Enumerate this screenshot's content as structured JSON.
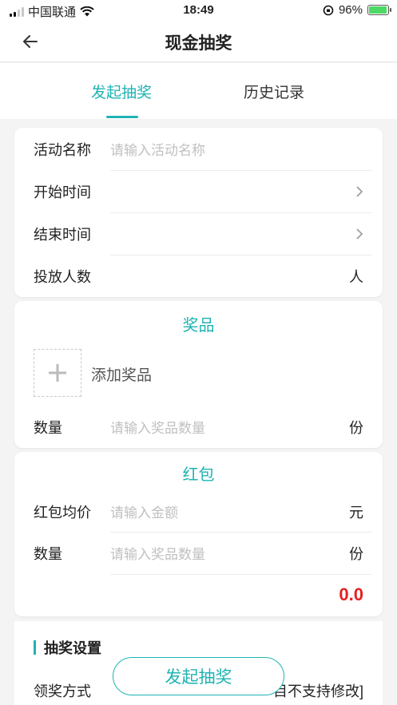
{
  "status_bar": {
    "carrier": "中国联通",
    "time": "18:49",
    "battery_percent": "96%",
    "battery_level": 0.96
  },
  "nav": {
    "title": "现金抽奖"
  },
  "tabs": [
    {
      "label": "发起抽奖",
      "active": true
    },
    {
      "label": "历史记录",
      "active": false
    }
  ],
  "activity": {
    "name_label": "活动名称",
    "name_placeholder": "请输入活动名称",
    "start_label": "开始时间",
    "end_label": "结束时间",
    "people_label": "投放人数",
    "people_unit": "人"
  },
  "prize": {
    "title": "奖品",
    "add_label": "添加奖品",
    "qty_label": "数量",
    "qty_placeholder": "请输入奖品数量",
    "qty_unit": "份"
  },
  "red_packet": {
    "title": "红包",
    "avg_label": "红包均价",
    "avg_placeholder": "请输入金额",
    "avg_unit": "元",
    "qty_label": "数量",
    "qty_placeholder": "请输入奖品数量",
    "qty_unit": "份",
    "total": "0.0"
  },
  "settings": {
    "title": "抽奖设置",
    "claim_label": "领奖方式",
    "claim_note": "目不支持修改]"
  },
  "launch_button": "发起抽奖",
  "colors": {
    "accent": "#1fb3b3",
    "total_red": "#e81f1f"
  }
}
